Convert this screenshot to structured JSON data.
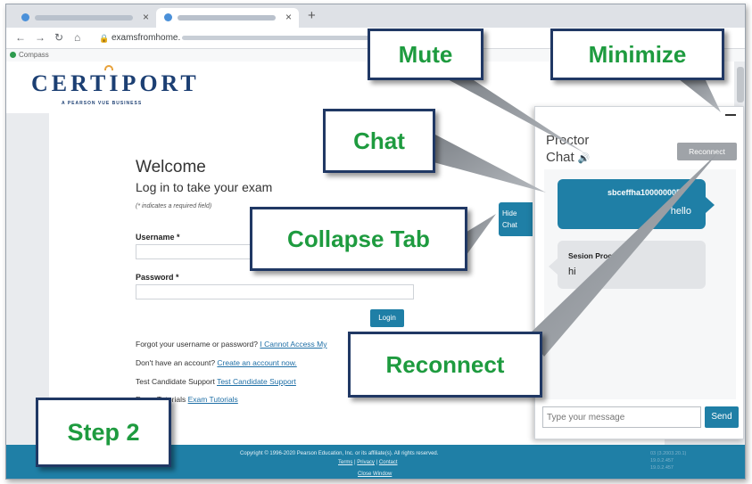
{
  "browser": {
    "tabs": [
      {
        "label": ""
      },
      {
        "label": ""
      }
    ],
    "address": "examsfromhome.",
    "compass_label": "Compass"
  },
  "brand": {
    "logo": "CERTIPORT",
    "tagline": "A PEARSON VUE BUSINESS"
  },
  "login": {
    "welcome": "Welcome",
    "subtitle": "Log in to take your exam",
    "required_note": "(* indicates a required field)",
    "username_label": "Username *",
    "password_label": "Password *",
    "login_button": "Login",
    "forgot_text": "Forgot your username or password?",
    "forgot_link": "I Cannot Access My",
    "no_account_text": "Don't have an account?",
    "create_link": "Create an account now.",
    "support_text": "Test Candidate Support",
    "support_link": "Test Candidate Support",
    "tutorials_text": "Exam Tutorials",
    "tutorials_link": "Exam Tutorials"
  },
  "footer": {
    "copyright": "Copyright © 1996-2020 Pearson Education, Inc. or its affiliate(s). All rights reserved.",
    "terms": "Terms",
    "privacy": "Privacy",
    "contact": "Contact",
    "close_window": "Close Window",
    "versions": [
      "03 (3.2003.20.1)",
      "19.0.2.457",
      "19.0.2.457"
    ]
  },
  "hide_chat": {
    "line1": "Hide",
    "line2": "Chat"
  },
  "chat": {
    "title_line1": "Proctor",
    "title_line2": "Chat",
    "reconnect_button": "Reconnect",
    "messages": [
      {
        "user": "sbceffha100000005",
        "text": "hello",
        "side": "self"
      },
      {
        "user": "Sesion Proctor",
        "text": "hi",
        "side": "other"
      }
    ],
    "input_placeholder": "Type your message",
    "send_button": "Send"
  },
  "callouts": {
    "mute": "Mute",
    "minimize": "Minimize",
    "chat": "Chat",
    "collapse": "Collapse Tab",
    "reconnect": "Reconnect",
    "step": "Step 2"
  },
  "colors": {
    "accent": "#1f7fa6",
    "callout_text": "#1e9b3f",
    "callout_border": "#203864",
    "brand": "#1c3f73"
  }
}
